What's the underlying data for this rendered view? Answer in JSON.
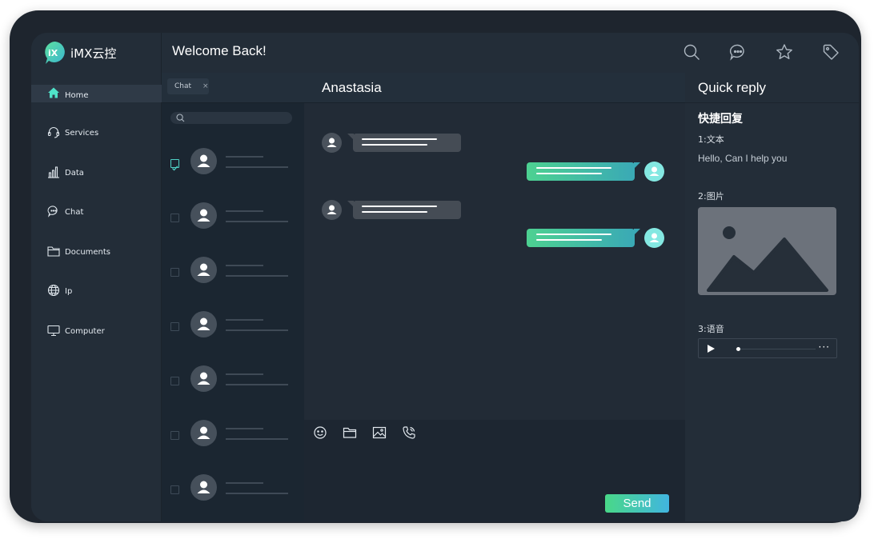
{
  "app": {
    "name": "iMX云控"
  },
  "sidebar": {
    "items": [
      {
        "label": "Home",
        "icon": "home-icon",
        "active": true
      },
      {
        "label": "Services",
        "icon": "headset-icon"
      },
      {
        "label": "Data",
        "icon": "bar-chart-icon"
      },
      {
        "label": "Chat",
        "icon": "chat-bubble-icon"
      },
      {
        "label": "Documents",
        "icon": "folder-icon"
      },
      {
        "label": "Ip",
        "icon": "globe-icon"
      },
      {
        "label": "Computer",
        "icon": "monitor-icon"
      }
    ]
  },
  "header": {
    "title": "Welcome Back!",
    "icons": [
      "search-icon",
      "chat-icon",
      "star-icon",
      "tag-icon"
    ]
  },
  "chatlist": {
    "tab": {
      "label": "Chat",
      "close": "×"
    },
    "search_placeholder": "",
    "contacts_checked": [
      true,
      false,
      false,
      false,
      false,
      false,
      false
    ]
  },
  "conversation": {
    "contact_name": "Anastasia",
    "send_label": "Send",
    "tools": [
      "emoji-icon",
      "folder-icon",
      "image-icon",
      "phone-icon"
    ]
  },
  "quick_reply": {
    "title": "Quick reply",
    "subtitle": "快捷回复",
    "section_text": "1:文本",
    "text_reply": "Hello, Can I help you",
    "section_image": "2:图片",
    "section_audio": "3:语音",
    "more": "···"
  },
  "colors": {
    "accent_green": "#49d888",
    "accent_blue": "#41b5e0",
    "accent_teal": "#4fd1c5"
  }
}
